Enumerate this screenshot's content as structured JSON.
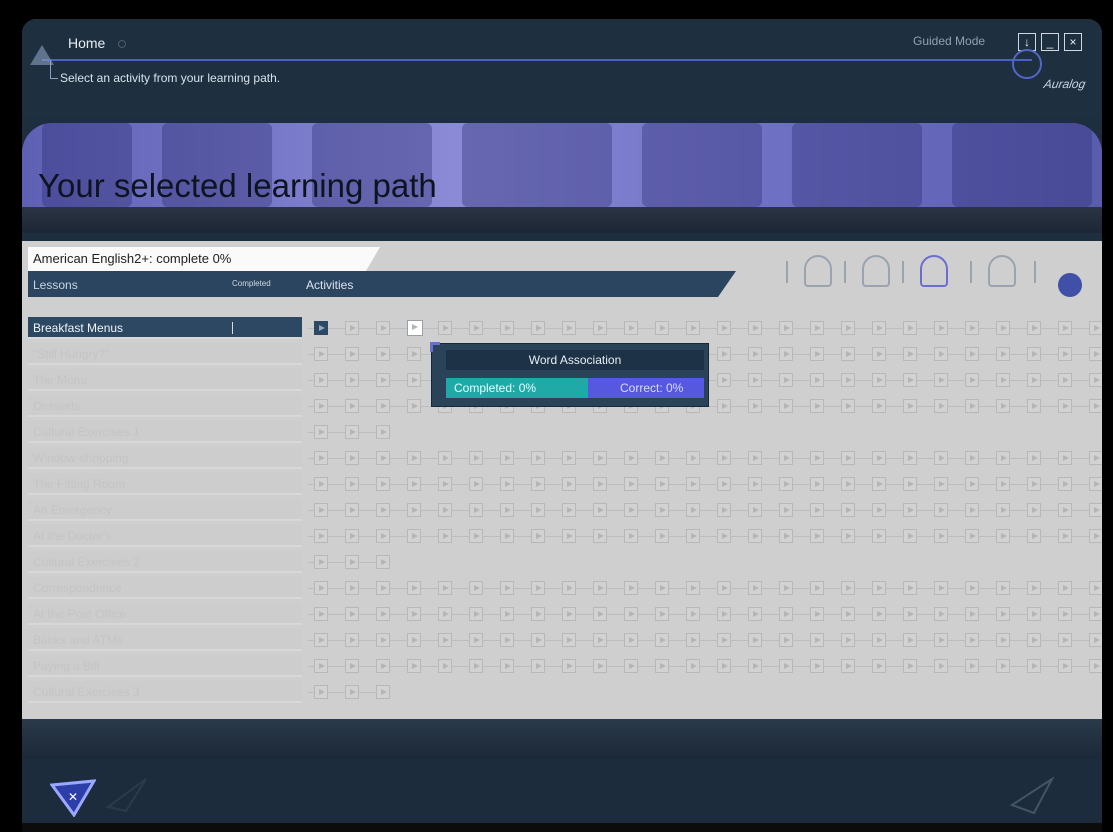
{
  "header": {
    "title": "Home",
    "instruction": "Select an activity from your learning path.",
    "mode_label": "Guided Mode",
    "window_buttons": [
      "↓",
      "_",
      "×"
    ],
    "logo_text": "Auralog"
  },
  "banner": {
    "title": "Your selected learning path"
  },
  "course": {
    "label": "American English2+: complete 0%",
    "columns": {
      "lessons": "Lessons",
      "completed": "Completed",
      "activities": "Activities"
    },
    "icons": [
      "listen-icon",
      "speak-icon",
      "dictation-icon",
      "pronunciation-icon",
      "hand-icon"
    ]
  },
  "lessons": [
    {
      "name": "Breakfast Menus",
      "activities": 26,
      "selected": true
    },
    {
      "name": "\"Still Hungry?\"",
      "activities": 26
    },
    {
      "name": "The Menu",
      "activities": 26
    },
    {
      "name": "Desserts",
      "activities": 26
    },
    {
      "name": "Cultural Exercises 1",
      "activities": 3
    },
    {
      "name": "Window-shopping",
      "activities": 26
    },
    {
      "name": "The Fitting Room",
      "activities": 26
    },
    {
      "name": "An Emergency",
      "activities": 26
    },
    {
      "name": "At the Doctor's",
      "activities": 26
    },
    {
      "name": "Cultural Exercises 2",
      "activities": 3
    },
    {
      "name": "Correspondence",
      "activities": 26
    },
    {
      "name": "At the Post Office",
      "activities": 26
    },
    {
      "name": "Banks and ATMs",
      "activities": 26
    },
    {
      "name": "Paying a Bill",
      "activities": 26
    },
    {
      "name": "Cultural Exercises 3",
      "activities": 3
    }
  ],
  "tooltip": {
    "title": "Word Association",
    "completed": "Completed: 0%",
    "correct": "Correct: 0%"
  }
}
